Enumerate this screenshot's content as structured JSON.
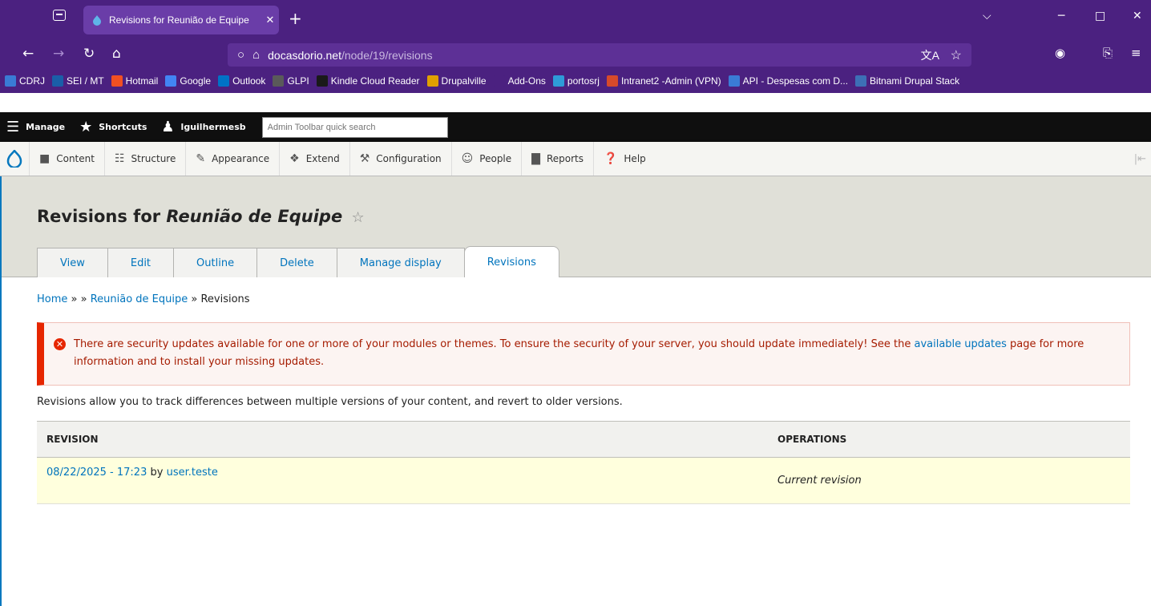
{
  "browser": {
    "tab_title": "Revisions for Reunião de Equipe",
    "tab_close": "✕",
    "new_tab": "+",
    "url_domain": "docasdorio.net",
    "url_path": "/node/19/revisions",
    "bookmarks": [
      {
        "label": "CDRJ",
        "color": "#3a7bd5"
      },
      {
        "label": "SEI / MT",
        "color": "#1a5ea8"
      },
      {
        "label": "Hotmail",
        "color": "#f25022"
      },
      {
        "label": "Google",
        "color": "#4285f4"
      },
      {
        "label": "Outlook",
        "color": "#0072c6"
      },
      {
        "label": "GLPI",
        "color": "#5a5a5a"
      },
      {
        "label": "Kindle Cloud Reader",
        "color": "#1a1a1a"
      },
      {
        "label": "Drupalville",
        "color": "#e0a000"
      },
      {
        "label": "Add-Ons",
        "color": "#4b2180"
      },
      {
        "label": "portosrj",
        "color": "#2e9bd8"
      },
      {
        "label": "Intranet2 -Admin (VPN)",
        "color": "#d64a2a"
      },
      {
        "label": "API - Despesas com D...",
        "color": "#3a7bd5"
      },
      {
        "label": "Bitnami Drupal Stack",
        "color": "#3d6fb6"
      }
    ]
  },
  "toolbar": {
    "manage": "Manage",
    "shortcuts": "Shortcuts",
    "user": "lguilhermesb",
    "search_placeholder": "Admin Toolbar quick search"
  },
  "admin_menu": [
    {
      "label": "Content",
      "icon": "content-icon"
    },
    {
      "label": "Structure",
      "icon": "structure-icon"
    },
    {
      "label": "Appearance",
      "icon": "appearance-icon"
    },
    {
      "label": "Extend",
      "icon": "extend-icon"
    },
    {
      "label": "Configuration",
      "icon": "configuration-icon"
    },
    {
      "label": "People",
      "icon": "people-icon"
    },
    {
      "label": "Reports",
      "icon": "reports-icon"
    },
    {
      "label": "Help",
      "icon": "help-icon"
    }
  ],
  "page": {
    "title_prefix": "Revisions for",
    "title_node": "Reunião de Equipe",
    "tabs": [
      "View",
      "Edit",
      "Outline",
      "Delete",
      "Manage display",
      "Revisions"
    ],
    "active_tab": "Revisions"
  },
  "breadcrumb": {
    "home": "Home",
    "sep1": " » » ",
    "node": "Reunião de Equipe",
    "sep2": " » ",
    "current": "Revisions"
  },
  "alert": {
    "text_before": "There are security updates available for one or more of your modules or themes. To ensure the security of your server, you should update immediately! See the ",
    "link": "available updates",
    "text_after": " page for more information and to install your missing updates."
  },
  "intro": "Revisions allow you to track differences between multiple versions of your content, and revert to older versions.",
  "table": {
    "headers": [
      "REVISION",
      "OPERATIONS"
    ],
    "rows": [
      {
        "date": "08/22/2025 - 17:23",
        "by": " by ",
        "user": "user.teste",
        "operation": "Current revision"
      }
    ]
  },
  "colors": {
    "browser_chrome": "#4b2180",
    "toolbar": "#0f0f0f",
    "link": "#0074bd",
    "error": "#e62600",
    "row_highlight": "#ffffdd"
  }
}
